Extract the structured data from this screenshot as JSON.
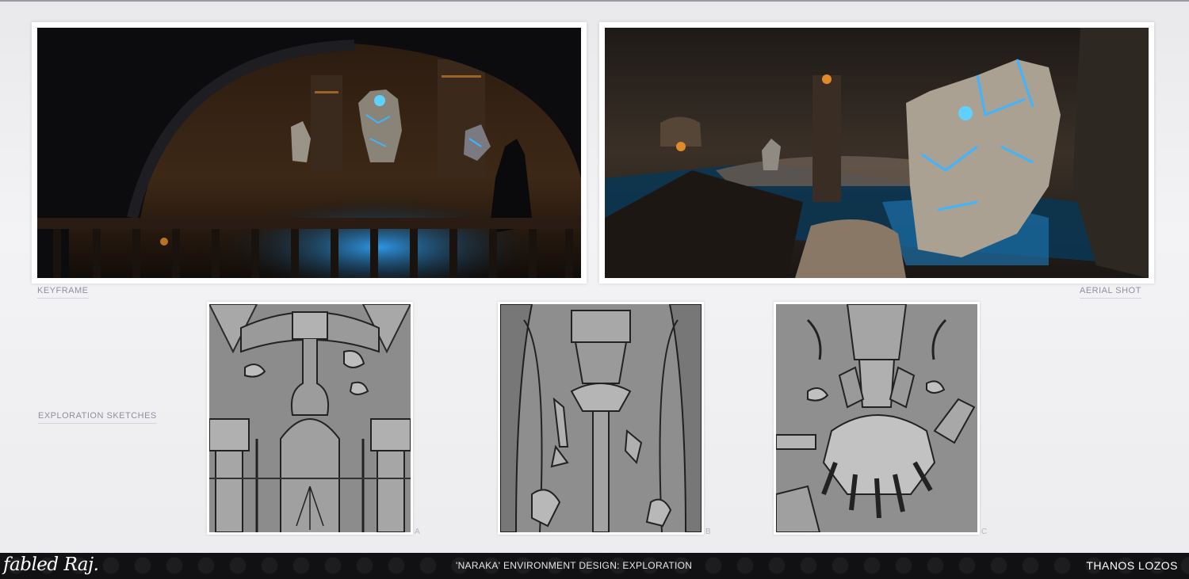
{
  "panels": {
    "keyframe": {
      "caption": "KEYFRAME"
    },
    "aerial": {
      "caption": "AERIAL SHOT"
    }
  },
  "exploration": {
    "caption": "EXPLORATION SKETCHES",
    "sketches": [
      {
        "letter": "A"
      },
      {
        "letter": "B"
      },
      {
        "letter": "C"
      }
    ]
  },
  "footer": {
    "logo": "fabled Raj.",
    "title": "'NARAKA' ENVIRONMENT DESIGN: EXPLORATION",
    "author": "THANOS LOZOS"
  },
  "colors": {
    "glow": "#3fb4ff",
    "torch": "#e08a2a",
    "footer_bg": "#111113"
  }
}
